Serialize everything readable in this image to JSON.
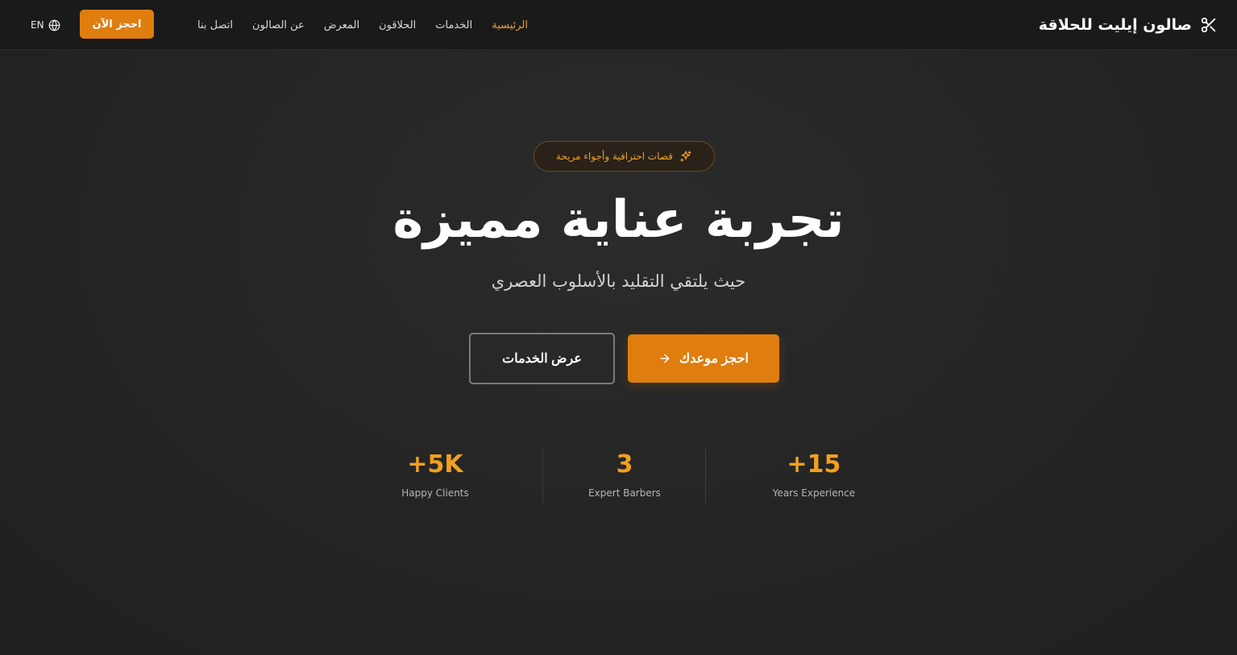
{
  "nav": {
    "brand": "صالون إيليت للحلاقة",
    "brand_icon": "scissors-icon",
    "links": [
      {
        "label": "الرئيسية",
        "active": true
      },
      {
        "label": "الخدمات",
        "active": false
      },
      {
        "label": "الحلاقون",
        "active": false
      },
      {
        "label": "المعرض",
        "active": false
      },
      {
        "label": "عن الصالون",
        "active": false
      },
      {
        "label": "اتصل بنا",
        "active": false
      }
    ],
    "book_now": "احجز الآن",
    "lang_label": "EN",
    "lang_icon": "globe-icon"
  },
  "hero": {
    "badge_text": "قصات احترافية وأجواء مريحة",
    "badge_icon": "sparkle-icon",
    "title": "تجربة عناية مميزة",
    "subtitle": "حيث يلتقي التقليد بالأسلوب العصري",
    "primary_button": "احجز موعدك",
    "primary_icon": "arrow-right-icon",
    "secondary_button": "عرض الخدمات"
  },
  "stats": [
    {
      "value": "+15",
      "label": "Years Experience"
    },
    {
      "value": "3",
      "label": "Expert Barbers"
    },
    {
      "value": "+5K",
      "label": "Happy Clients"
    }
  ],
  "colors": {
    "accent": "#df7d0e",
    "accent_text": "#f0a020",
    "background": "#232323",
    "nav_background": "#1a1a1a"
  }
}
